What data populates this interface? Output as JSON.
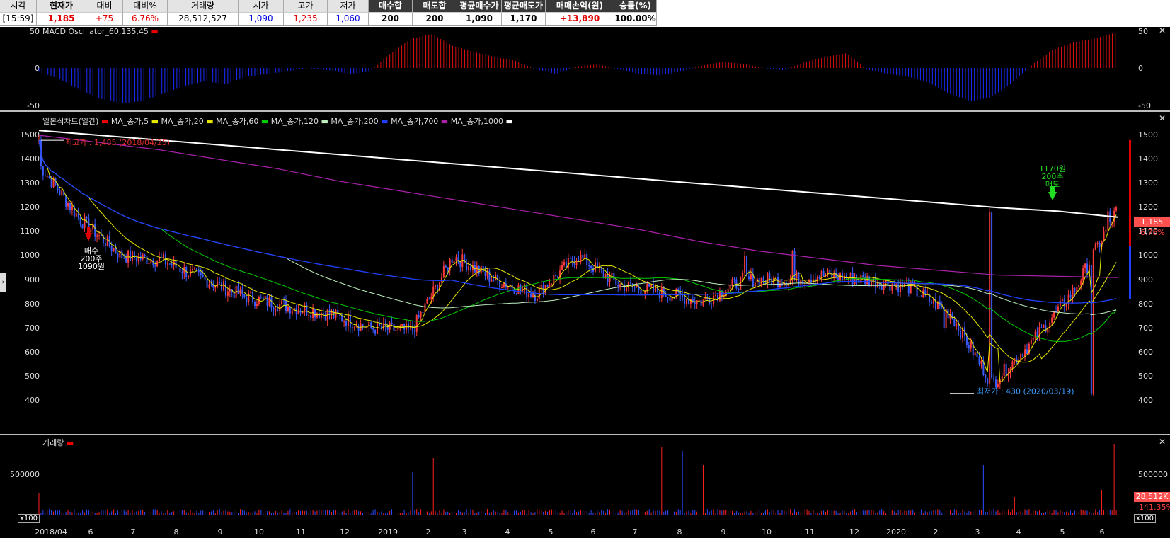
{
  "header": {
    "columns": [
      {
        "label": "시각",
        "value": "[15:59]"
      },
      {
        "label": "현재가",
        "value": "1,185"
      },
      {
        "label": "대비",
        "value": "+75"
      },
      {
        "label": "대비%",
        "value": "6.76%"
      },
      {
        "label": "거래량",
        "value": "28,512,527"
      },
      {
        "label": "시가",
        "value": "1,090"
      },
      {
        "label": "고가",
        "value": "1,235"
      },
      {
        "label": "저가",
        "value": "1,060"
      },
      {
        "label": "매수합",
        "value": "200"
      },
      {
        "label": "매도합",
        "value": "200"
      },
      {
        "label": "평균매수가",
        "value": "1,090"
      },
      {
        "label": "평균매도가",
        "value": "1,170"
      },
      {
        "label": "매매손익(원)",
        "value": "+13,890"
      },
      {
        "label": "승률(%)",
        "value": "100.00%"
      }
    ]
  },
  "macd": {
    "title": "MACD Oscillator_60,135,45",
    "yticks": [
      "50",
      "0",
      "-50"
    ]
  },
  "price": {
    "title": "일본식차트(일간)",
    "legend": [
      {
        "label": "MA_종가,5",
        "color": "#e8e800"
      },
      {
        "label": "MA_종가,20",
        "color": "#e8e800"
      },
      {
        "label": "MA_종가,60",
        "color": "#00cc00"
      },
      {
        "label": "MA_종가,120",
        "color": "#bff0bf"
      },
      {
        "label": "MA_종가,200",
        "color": "#2040ff"
      },
      {
        "label": "MA_종가,700",
        "color": "#aa22aa"
      },
      {
        "label": "MA_종가,1000",
        "color": "#ffffff"
      }
    ],
    "yticks": [
      "1500",
      "1400",
      "1300",
      "1200",
      "1100",
      "1000",
      "900",
      "800",
      "700",
      "600",
      "500",
      "400"
    ],
    "high_label": "최고가 : 1,485 (2018/04/25)",
    "low_label": "최저가 : 430 (2020/03/19)",
    "buy_label": [
      "매수",
      "200주",
      "1090원"
    ],
    "sell_label": [
      "1170원",
      "200주",
      "매도"
    ],
    "current_price": "1,185",
    "current_pct": "6.76%"
  },
  "volume": {
    "title": "거래량",
    "ytick": "500000",
    "tag": "28,512K",
    "pct": "141.35%",
    "scale_label": "x100"
  },
  "xaxis": [
    "2018/04",
    "6",
    "7",
    "8",
    "9",
    "10",
    "11",
    "12",
    "2019",
    "2",
    "3",
    "4",
    "5",
    "6",
    "7",
    "8",
    "9",
    "10",
    "11",
    "12",
    "2020",
    "2",
    "3",
    "4",
    "5",
    "6"
  ],
  "chart_data": {
    "type": "candlestick",
    "title": "일본식차트(일간)",
    "period": "2018/04 - 2020/06",
    "price_ylim": [
      400,
      1500
    ],
    "high": {
      "value": 1485,
      "date": "2018/04/25"
    },
    "low": {
      "value": 430,
      "date": "2020/03/19"
    },
    "close_series_approx": {
      "x": [
        "2018/04",
        "2018/05",
        "2018/06",
        "2018/07",
        "2018/08",
        "2018/09",
        "2018/10",
        "2018/11",
        "2018/12",
        "2019/01",
        "2019/02",
        "2019/03",
        "2019/04",
        "2019/05",
        "2019/06",
        "2019/07",
        "2019/08",
        "2019/09",
        "2019/10",
        "2019/11",
        "2019/12",
        "2020/01",
        "2020/02",
        "2020/03",
        "2020/04",
        "2020/05",
        "2020/06"
      ],
      "values": [
        1380,
        1150,
        1000,
        980,
        900,
        830,
        790,
        760,
        700,
        690,
        1000,
        900,
        840,
        1000,
        880,
        850,
        810,
        900,
        900,
        920,
        900,
        870,
        760,
        470,
        650,
        860,
        1185
      ]
    },
    "series": [
      {
        "name": "MA_종가,1000",
        "values": [
          1520,
          1500,
          1480,
          1460,
          1440,
          1420,
          1400,
          1380,
          1360,
          1340,
          1320,
          1300,
          1280,
          1260,
          1240,
          1220,
          1200,
          1185,
          1160
        ]
      },
      {
        "name": "MA_종가,700",
        "values": [
          1500,
          1470,
          1440,
          1400,
          1360,
          1310,
          1270,
          1230,
          1190,
          1150,
          1110,
          1060,
          1020,
          990,
          960,
          940,
          920,
          915,
          910
        ]
      }
    ],
    "macd_oscillator": {
      "name": "MACD Oscillator_60,135,45",
      "ylim": [
        -50,
        50
      ]
    },
    "volume_ylim": [
      0,
      1000000
    ],
    "current": {
      "price": 1185,
      "change": 75,
      "pct": 6.76,
      "volume": 28512527
    }
  }
}
